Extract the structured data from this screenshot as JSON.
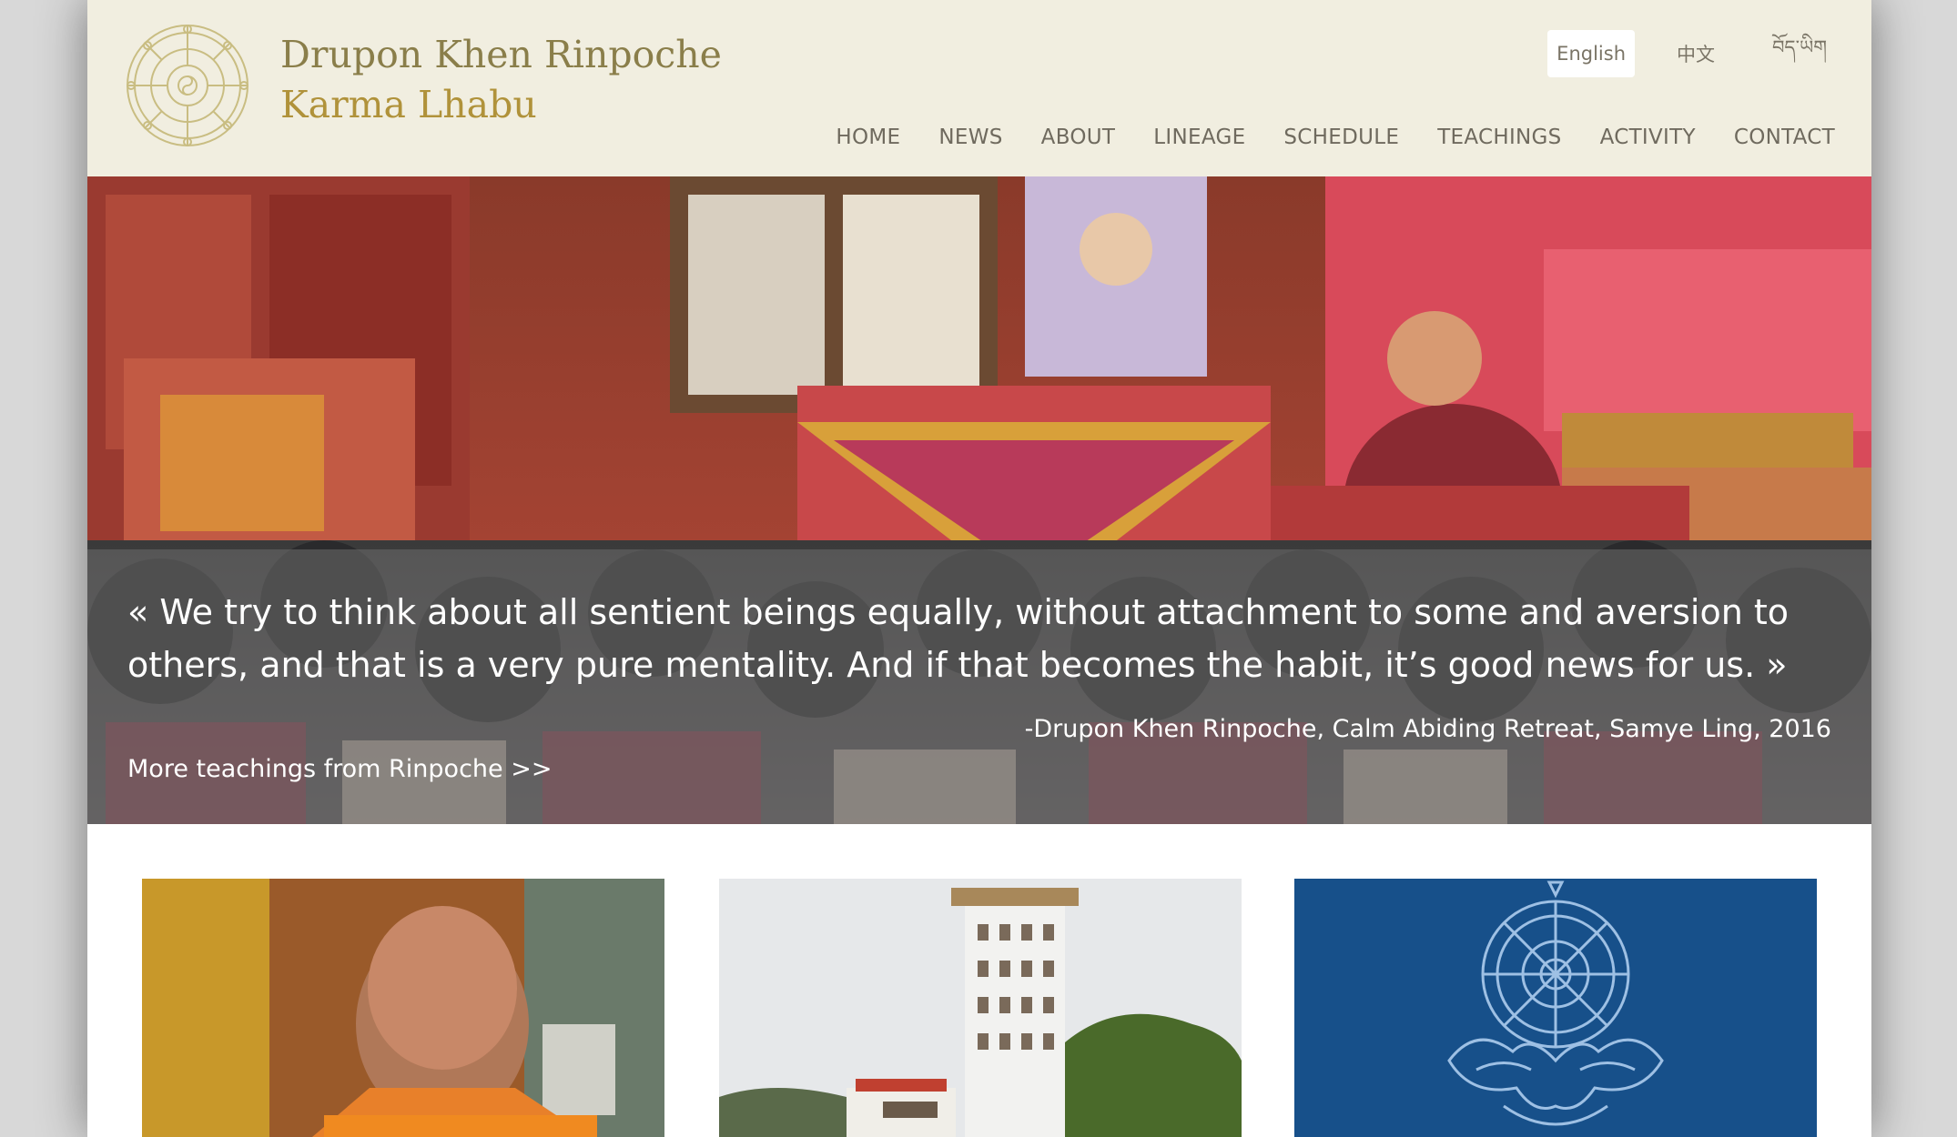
{
  "header": {
    "title_line1": "Drupon Khen Rinpoche",
    "title_line2": "Karma Lhabu",
    "logo_icon": "dharma-wheel-icon"
  },
  "languages": [
    {
      "label": "English",
      "active": true
    },
    {
      "label": "中文",
      "active": false
    },
    {
      "label": "བོད་ཡིག",
      "active": false
    }
  ],
  "nav": [
    "HOME",
    "NEWS",
    "ABOUT",
    "LINEAGE",
    "SCHEDULE",
    "TEACHINGS",
    "ACTIVITY",
    "CONTACT"
  ],
  "hero": {
    "quote": "« We try to think about all sentient beings equally, without attachment to some and aversion to others, and that is a very pure mentality. And if that becomes the habit, it’s good news for us. »",
    "attribution": "-Drupon Khen Rinpoche, Calm Abiding Retreat, Samye Ling, 2016",
    "link": "More teachings from Rinpoche >>"
  },
  "colors": {
    "header_bg": "#f1eee0",
    "title_primary": "#8a7e4a",
    "title_secondary": "#b0923a",
    "nav_text": "#6f6a5e",
    "card3_bg": "#17508a"
  }
}
